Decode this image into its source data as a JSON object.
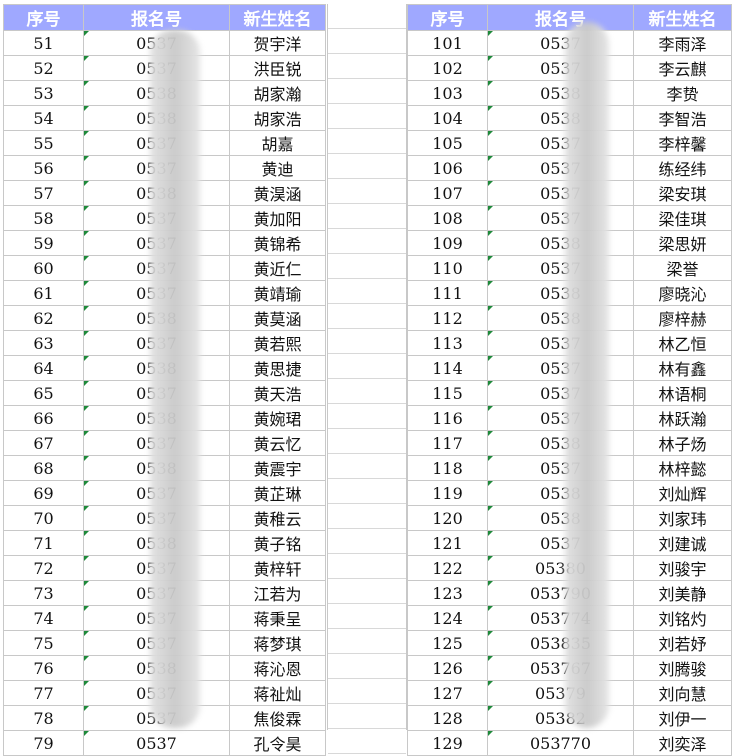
{
  "headers": {
    "seq": "序号",
    "reg": "报名号",
    "name": "新生姓名"
  },
  "left_rows": [
    {
      "seq": "51",
      "reg": "0537",
      "name": "贺宇洋"
    },
    {
      "seq": "52",
      "reg": "0537",
      "name": "洪臣锐"
    },
    {
      "seq": "53",
      "reg": "0538",
      "name": "胡家瀚"
    },
    {
      "seq": "54",
      "reg": "0538",
      "name": "胡家浩"
    },
    {
      "seq": "55",
      "reg": "0537",
      "name": "胡嘉"
    },
    {
      "seq": "56",
      "reg": "0537",
      "name": "黄迪"
    },
    {
      "seq": "57",
      "reg": "0538",
      "name": "黄淏涵"
    },
    {
      "seq": "58",
      "reg": "0537",
      "name": "黄加阳"
    },
    {
      "seq": "59",
      "reg": "0537",
      "name": "黄锦希"
    },
    {
      "seq": "60",
      "reg": "0537",
      "name": "黄近仁"
    },
    {
      "seq": "61",
      "reg": "0537",
      "name": "黄靖瑜"
    },
    {
      "seq": "62",
      "reg": "0538",
      "name": "黄莫涵"
    },
    {
      "seq": "63",
      "reg": "0537",
      "name": "黄若熙"
    },
    {
      "seq": "64",
      "reg": "0538",
      "name": "黄思捷"
    },
    {
      "seq": "65",
      "reg": "0537",
      "name": "黄天浩"
    },
    {
      "seq": "66",
      "reg": "0538",
      "name": "黄婉珺"
    },
    {
      "seq": "67",
      "reg": "0537",
      "name": "黄云忆"
    },
    {
      "seq": "68",
      "reg": "0538",
      "name": "黄震宇"
    },
    {
      "seq": "69",
      "reg": "0537",
      "name": "黄芷琳"
    },
    {
      "seq": "70",
      "reg": "0537",
      "name": "黄稚云"
    },
    {
      "seq": "71",
      "reg": "0538",
      "name": "黄子铭"
    },
    {
      "seq": "72",
      "reg": "0537",
      "name": "黄梓轩"
    },
    {
      "seq": "73",
      "reg": "0537",
      "name": "江若为"
    },
    {
      "seq": "74",
      "reg": "0537",
      "name": "蒋秉呈"
    },
    {
      "seq": "75",
      "reg": "0537",
      "name": "蒋梦琪"
    },
    {
      "seq": "76",
      "reg": "0538",
      "name": "蒋沁恩"
    },
    {
      "seq": "77",
      "reg": "0537",
      "name": "蒋祉灿"
    },
    {
      "seq": "78",
      "reg": "0537",
      "name": "焦俊霖"
    },
    {
      "seq": "79",
      "reg": "0537",
      "name": "孔令昊"
    }
  ],
  "right_rows": [
    {
      "seq": "101",
      "reg": "0537",
      "name": "李雨泽"
    },
    {
      "seq": "102",
      "reg": "0537",
      "name": "李云麒"
    },
    {
      "seq": "103",
      "reg": "0538",
      "name": "李贽"
    },
    {
      "seq": "104",
      "reg": "0538",
      "name": "李智浩"
    },
    {
      "seq": "105",
      "reg": "0537",
      "name": "李梓馨"
    },
    {
      "seq": "106",
      "reg": "0537",
      "name": "练经纬"
    },
    {
      "seq": "107",
      "reg": "0537",
      "name": "梁安琪"
    },
    {
      "seq": "108",
      "reg": "0537",
      "name": "梁佳琪"
    },
    {
      "seq": "109",
      "reg": "0538",
      "name": "梁思妍"
    },
    {
      "seq": "110",
      "reg": "0537",
      "name": "梁誉"
    },
    {
      "seq": "111",
      "reg": "0538",
      "name": "廖晓沁"
    },
    {
      "seq": "112",
      "reg": "0538",
      "name": "廖梓赫"
    },
    {
      "seq": "113",
      "reg": "0537",
      "name": "林乙恒"
    },
    {
      "seq": "114",
      "reg": "0537",
      "name": "林有鑫"
    },
    {
      "seq": "115",
      "reg": "0537",
      "name": "林语桐"
    },
    {
      "seq": "116",
      "reg": "0537",
      "name": "林跃瀚"
    },
    {
      "seq": "117",
      "reg": "0538",
      "name": "林子炀"
    },
    {
      "seq": "118",
      "reg": "0537",
      "name": "林梓懿"
    },
    {
      "seq": "119",
      "reg": "0538",
      "name": "刘灿辉"
    },
    {
      "seq": "120",
      "reg": "0538",
      "name": "刘家玮"
    },
    {
      "seq": "121",
      "reg": "0537",
      "name": "刘建诚"
    },
    {
      "seq": "122",
      "reg": "05380",
      "name": "刘骏宇"
    },
    {
      "seq": "123",
      "reg": "053790",
      "name": "刘美静"
    },
    {
      "seq": "124",
      "reg": "053774",
      "name": "刘铭灼"
    },
    {
      "seq": "125",
      "reg": "053835",
      "name": "刘若妤"
    },
    {
      "seq": "126",
      "reg": "053767",
      "name": "刘腾骏"
    },
    {
      "seq": "127",
      "reg": "05379",
      "name": "刘向慧"
    },
    {
      "seq": "128",
      "reg": "05382",
      "name": "刘伊一"
    },
    {
      "seq": "129",
      "reg": "053770",
      "name": "刘奕泽"
    }
  ]
}
